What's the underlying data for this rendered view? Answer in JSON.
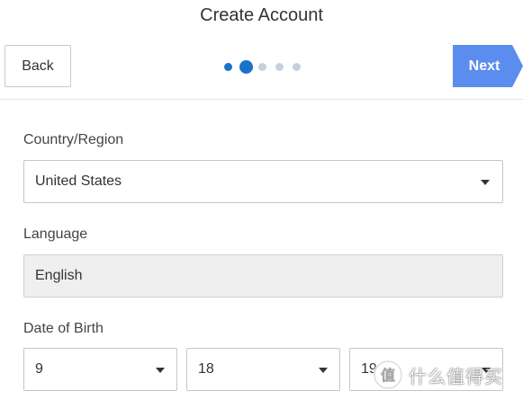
{
  "header": {
    "title": "Create Account",
    "back_label": "Back",
    "next_label": "Next",
    "steps": {
      "total": 5,
      "current": 2
    }
  },
  "form": {
    "country": {
      "label": "Country/Region",
      "value": "United States"
    },
    "language": {
      "label": "Language",
      "value": "English"
    },
    "dob": {
      "label": "Date of Birth",
      "month": "9",
      "day": "18",
      "year": "19"
    }
  },
  "watermark": {
    "text": "什么值得买"
  },
  "colors": {
    "accent": "#5b8def",
    "step_active": "#1a73c8",
    "step_inactive": "#c7d1dc",
    "disabled_bg": "#efefef"
  }
}
